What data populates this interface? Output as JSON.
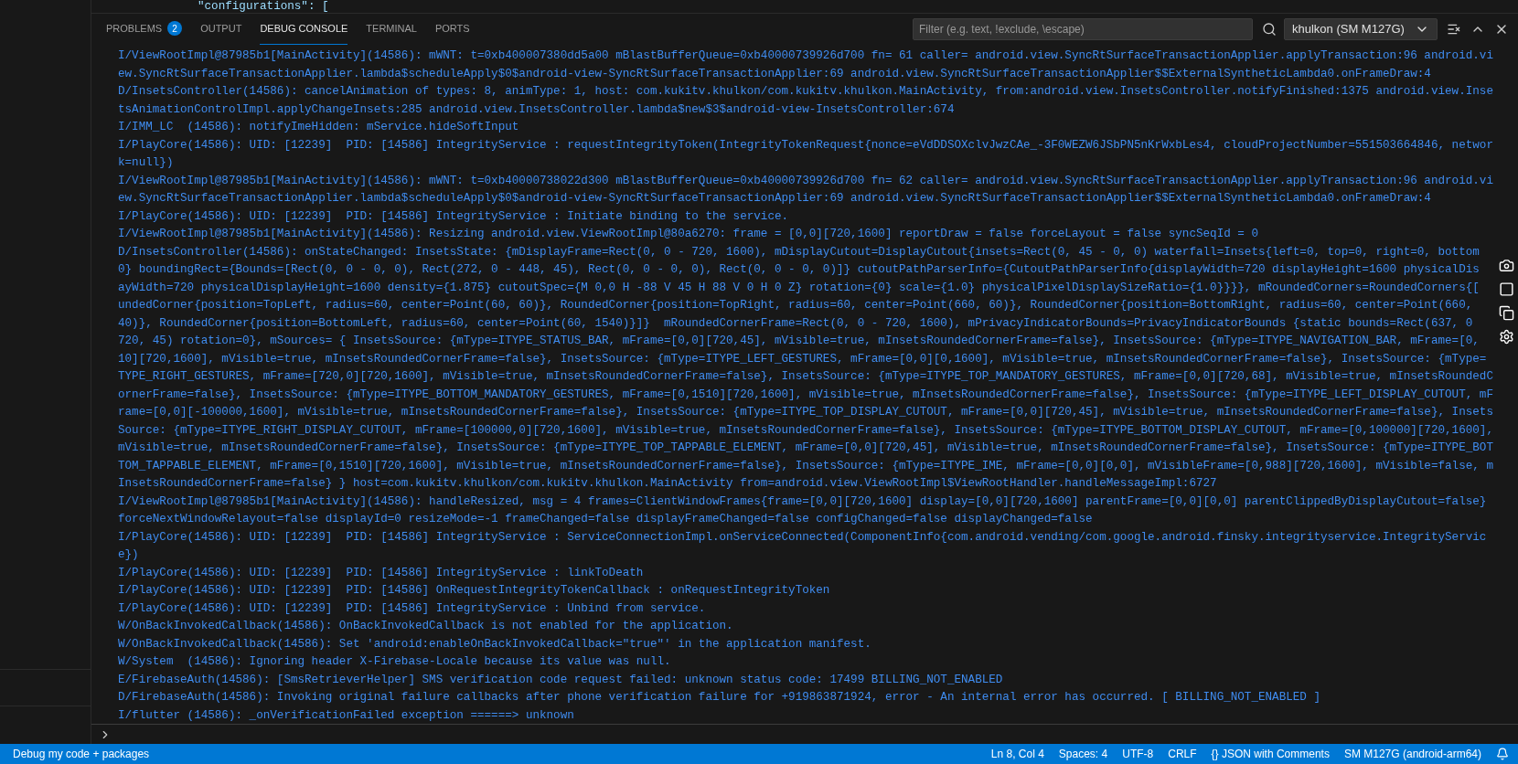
{
  "editor": {
    "line_text": "\"configurations\": ["
  },
  "panel": {
    "tabs": [
      {
        "label": "PROBLEMS",
        "badge": "2",
        "selected": false
      },
      {
        "label": "OUTPUT",
        "selected": false
      },
      {
        "label": "DEBUG CONSOLE",
        "selected": true
      },
      {
        "label": "TERMINAL",
        "selected": false
      },
      {
        "label": "PORTS",
        "selected": false
      }
    ],
    "filter": {
      "placeholder": "Filter (e.g. text, !exclude, \\escape)"
    },
    "session_select": {
      "value": "khulkon (SM M127G)"
    }
  },
  "console": {
    "lines": [
      "I/ViewRootImpl@87985b1[MainActivity](14586): mWNT: t=0xb400007380dd5a00 mBlastBufferQueue=0xb40000739926d700 fn= 61 caller= android.view.SyncRtSurfaceTransactionApplier.applyTransaction:96 android.vi",
      "ew.SyncRtSurfaceTransactionApplier.lambda$scheduleApply$0$android-view-SyncRtSurfaceTransactionApplier:69 android.view.SyncRtSurfaceTransactionApplier$$ExternalSyntheticLambda0.onFrameDraw:4",
      "D/InsetsController(14586): cancelAnimation of types: 8, animType: 1, host: com.kukitv.khulkon/com.kukitv.khulkon.MainActivity, from:android.view.InsetsController.notifyFinished:1375 android.view.Inse",
      "tsAnimationControlImpl.applyChangeInsets:285 android.view.InsetsController.lambda$new$3$android-view-InsetsController:674",
      "I/IMM_LC  (14586): notifyImeHidden: mService.hideSoftInput",
      "I/PlayCore(14586): UID: [12239]  PID: [14586] IntegrityService : requestIntegrityToken(IntegrityTokenRequest{nonce=eVdDDSOXclvJwzCAe_-3F0WEZW6JSbPN5nKrWxbLes4, cloudProjectNumber=551503664846, networ",
      "k=null})",
      "I/ViewRootImpl@87985b1[MainActivity](14586): mWNT: t=0xb40000738022d300 mBlastBufferQueue=0xb40000739926d700 fn= 62 caller= android.view.SyncRtSurfaceTransactionApplier.applyTransaction:96 android.vi",
      "ew.SyncRtSurfaceTransactionApplier.lambda$scheduleApply$0$android-view-SyncRtSurfaceTransactionApplier:69 android.view.SyncRtSurfaceTransactionApplier$$ExternalSyntheticLambda0.onFrameDraw:4",
      "I/PlayCore(14586): UID: [12239]  PID: [14586] IntegrityService : Initiate binding to the service.",
      "I/ViewRootImpl@87985b1[MainActivity](14586): Resizing android.view.ViewRootImpl@80a6270: frame = [0,0][720,1600] reportDraw = false forceLayout = false syncSeqId = 0",
      "D/InsetsController(14586): onStateChanged: InsetsState: {mDisplayFrame=Rect(0, 0 - 720, 1600), mDisplayCutout=DisplayCutout{insets=Rect(0, 45 - 0, 0) waterfall=Insets{left=0, top=0, right=0, bottom",
      "0} boundingRect={Bounds=[Rect(0, 0 - 0, 0), Rect(272, 0 - 448, 45), Rect(0, 0 - 0, 0), Rect(0, 0 - 0, 0)]} cutoutPathParserInfo={CutoutPathParserInfo{displayWidth=720 displayHeight=1600 physicalDis",
      "ayWidth=720 physicalDisplayHeight=1600 density={1.875} cutoutSpec={M 0,0 H -88 V 45 H 88 V 0 H 0 Z} rotation={0} scale={1.0} physicalPixelDisplaySizeRatio={1.0}}}}, mRoundedCorners=RoundedCorners{[",
      "undedCorner{position=TopLeft, radius=60, center=Point(60, 60)}, RoundedCorner{position=TopRight, radius=60, center=Point(660, 60)}, RoundedCorner{position=BottomRight, radius=60, center=Point(660,",
      "40)}, RoundedCorner{position=BottomLeft, radius=60, center=Point(60, 1540)}]}  mRoundedCornerFrame=Rect(0, 0 - 720, 1600), mPrivacyIndicatorBounds=PrivacyIndicatorBounds {static bounds=Rect(637, 0",
      "720, 45) rotation=0}, mSources= { InsetsSource: {mType=ITYPE_STATUS_BAR, mFrame=[0,0][720,45], mVisible=true, mInsetsRoundedCornerFrame=false}, InsetsSource: {mType=ITYPE_NAVIGATION_BAR, mFrame=[0,",
      "10][720,1600], mVisible=true, mInsetsRoundedCornerFrame=false}, InsetsSource: {mType=ITYPE_LEFT_GESTURES, mFrame=[0,0][0,1600], mVisible=true, mInsetsRoundedCornerFrame=false}, InsetsSource: {mType=",
      "TYPE_RIGHT_GESTURES, mFrame=[720,0][720,1600], mVisible=true, mInsetsRoundedCornerFrame=false}, InsetsSource: {mType=ITYPE_TOP_MANDATORY_GESTURES, mFrame=[0,0][720,68], mVisible=true, mInsetsRoundedC",
      "ornerFrame=false}, InsetsSource: {mType=ITYPE_BOTTOM_MANDATORY_GESTURES, mFrame=[0,1510][720,1600], mVisible=true, mInsetsRoundedCornerFrame=false}, InsetsSource: {mType=ITYPE_LEFT_DISPLAY_CUTOUT, mF",
      "rame=[0,0][-100000,1600], mVisible=true, mInsetsRoundedCornerFrame=false}, InsetsSource: {mType=ITYPE_TOP_DISPLAY_CUTOUT, mFrame=[0,0][720,45], mVisible=true, mInsetsRoundedCornerFrame=false}, Insets",
      "Source: {mType=ITYPE_RIGHT_DISPLAY_CUTOUT, mFrame=[100000,0][720,1600], mVisible=true, mInsetsRoundedCornerFrame=false}, InsetsSource: {mType=ITYPE_BOTTOM_DISPLAY_CUTOUT, mFrame=[0,100000][720,1600],",
      "mVisible=true, mInsetsRoundedCornerFrame=false}, InsetsSource: {mType=ITYPE_TOP_TAPPABLE_ELEMENT, mFrame=[0,0][720,45], mVisible=true, mInsetsRoundedCornerFrame=false}, InsetsSource: {mType=ITYPE_BOT",
      "TOM_TAPPABLE_ELEMENT, mFrame=[0,1510][720,1600], mVisible=true, mInsetsRoundedCornerFrame=false}, InsetsSource: {mType=ITYPE_IME, mFrame=[0,0][0,0], mVisibleFrame=[0,988][720,1600], mVisible=false, m",
      "InsetsRoundedCornerFrame=false} } host=com.kukitv.khulkon/com.kukitv.khulkon.MainActivity from=android.view.ViewRootImpl$ViewRootHandler.handleMessageImpl:6727",
      "I/ViewRootImpl@87985b1[MainActivity](14586): handleResized, msg = 4 frames=ClientWindowFrames{frame=[0,0][720,1600] display=[0,0][720,1600] parentFrame=[0,0][0,0] parentClippedByDisplayCutout=false}",
      "forceNextWindowRelayout=false displayId=0 resizeMode=-1 frameChanged=false displayFrameChanged=false configChanged=false displayChanged=false",
      "I/PlayCore(14586): UID: [12239]  PID: [14586] IntegrityService : ServiceConnectionImpl.onServiceConnected(ComponentInfo{com.android.vending/com.google.android.finsky.integrityservice.IntegrityServic",
      "e})",
      "I/PlayCore(14586): UID: [12239]  PID: [14586] IntegrityService : linkToDeath",
      "I/PlayCore(14586): UID: [12239]  PID: [14586] OnRequestIntegrityTokenCallback : onRequestIntegrityToken",
      "I/PlayCore(14586): UID: [12239]  PID: [14586] IntegrityService : Unbind from service.",
      "W/OnBackInvokedCallback(14586): OnBackInvokedCallback is not enabled for the application.",
      "W/OnBackInvokedCallback(14586): Set 'android:enableOnBackInvokedCallback=\"true\"' in the application manifest.",
      "W/System  (14586): Ignoring header X-Firebase-Locale because its value was null.",
      "E/FirebaseAuth(14586): [SmsRetrieverHelper] SMS verification code request failed: unknown status code: 17499 BILLING_NOT_ENABLED",
      "D/FirebaseAuth(14586): Invoking original failure callbacks after phone verification failure for +919863871924, error - An internal error has occurred. [ BILLING_NOT_ENABLED ]",
      "I/flutter (14586): _onVerificationFailed exception ======> unknown"
    ]
  },
  "status_bar": {
    "left": "Debug my code + packages",
    "items": [
      "Ln 8, Col 4",
      "Spaces: 4",
      "UTF-8",
      "CRLF",
      "{} JSON with Comments",
      "SM M127G (android-arm64)"
    ]
  }
}
